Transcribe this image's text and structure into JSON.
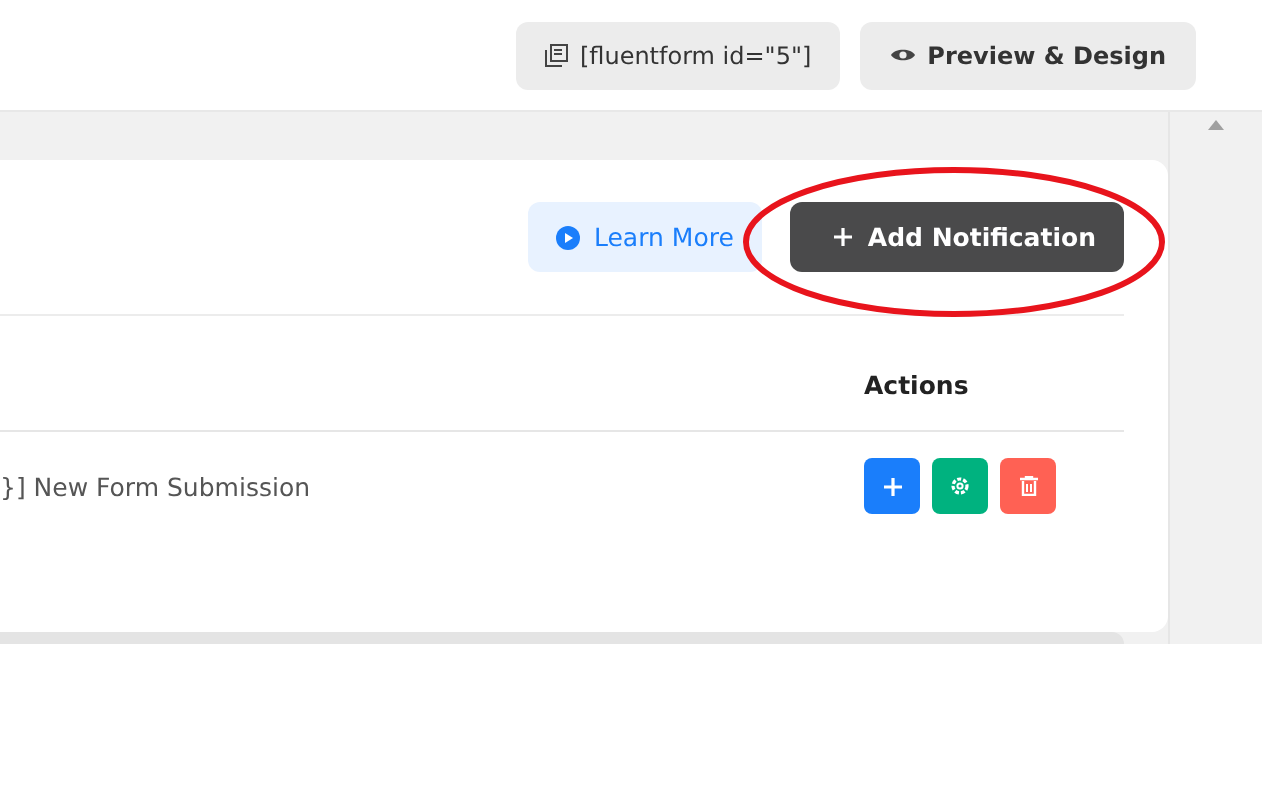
{
  "top_bar": {
    "shortcode_button": "[fluentform id=\"5\"]",
    "preview_button": "Preview & Design"
  },
  "card": {
    "learn_more_button": "Learn More",
    "add_button": "Add Notification",
    "highlighted": true
  },
  "table": {
    "columns": [
      "Actions"
    ],
    "rows": [
      {
        "title": "}] New Form Submission"
      }
    ]
  }
}
